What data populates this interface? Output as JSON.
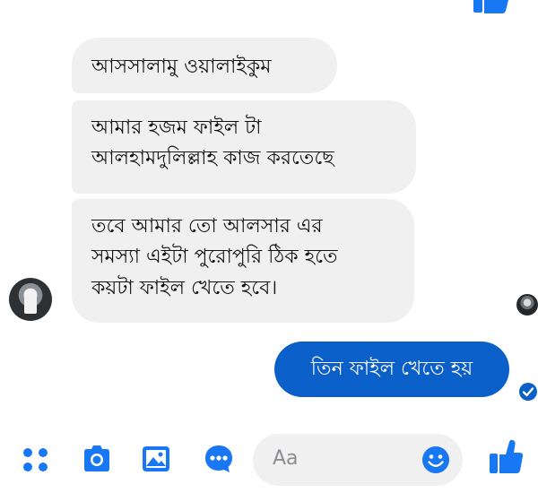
{
  "conversation": {
    "incoming": [
      "আসসালামু ওয়ালাইকুম",
      "আমার হজম ফাইল টা\nআলহামদুলিল্লাহ কাজ করতেছে",
      "তবে আমার তো আলসার এর\nসমস্যা এইটা পুরোপুরি ঠিক হতে\nকয়টা ফাইল খেতে হবে।"
    ],
    "outgoing": [
      "তিন ফাইল খেতে হয়"
    ]
  },
  "composer": {
    "placeholder": "Aa"
  },
  "colors": {
    "accent": "#0b5fc8",
    "incoming_bubble": "#f0f0f0",
    "icon_blue": "#1877f2"
  },
  "icons": {
    "apps": "apps-icon",
    "camera": "camera-icon",
    "gallery": "gallery-icon",
    "chat": "chat-bubble-icon",
    "emoji": "emoji-icon",
    "like": "thumbs-up-icon",
    "seen": "check-circle-icon"
  }
}
